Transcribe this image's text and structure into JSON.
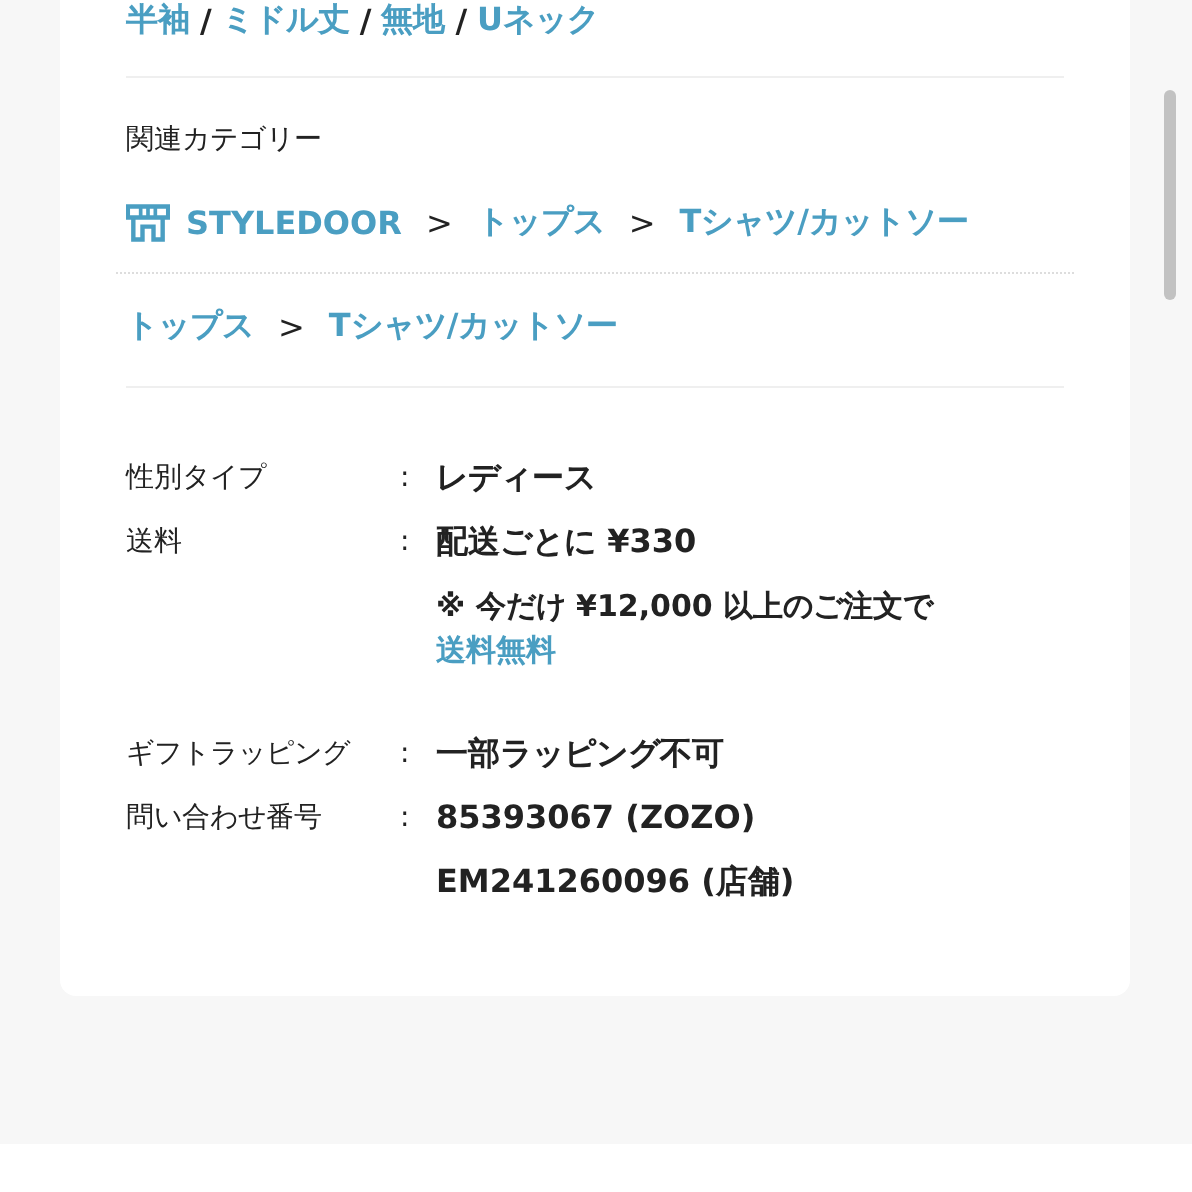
{
  "tags": [
    {
      "kind": "link",
      "text": "半袖"
    },
    {
      "kind": "separator",
      "text": "/"
    },
    {
      "kind": "link",
      "text": "ミドル丈"
    },
    {
      "kind": "separator",
      "text": "/"
    },
    {
      "kind": "link",
      "text": "無地"
    },
    {
      "kind": "separator",
      "text": "/"
    },
    {
      "kind": "link",
      "text": "Uネック"
    }
  ],
  "related_categories": {
    "heading": "関連カテゴリー",
    "paths": [
      {
        "kind": "shop",
        "items": [
          {
            "kind": "link",
            "text": "STYLEDOOR"
          },
          {
            "kind": "separator",
            "text": ">"
          },
          {
            "kind": "link",
            "text": "トップス"
          },
          {
            "kind": "separator",
            "text": ">"
          },
          {
            "kind": "link",
            "text": "Tシャツ/カットソー"
          }
        ]
      },
      {
        "kind": "category",
        "items": [
          {
            "kind": "link",
            "text": "トップス"
          },
          {
            "kind": "separator",
            "text": ">"
          },
          {
            "kind": "link",
            "text": "Tシャツ/カットソー"
          }
        ]
      }
    ]
  },
  "details": [
    {
      "label": "性別タイプ",
      "colon": ":",
      "values": [
        {
          "kind": "text",
          "text": "レディース"
        }
      ]
    },
    {
      "label": "送料",
      "colon": ":",
      "values": [
        {
          "kind": "text",
          "text": "配送ごとに ¥330"
        },
        {
          "kind": "note",
          "text": "※ 今だけ ¥12,000 以上のご注文で",
          "link": "送料無料"
        }
      ]
    },
    {
      "label": "ギフトラッピング",
      "colon": ":",
      "values": [
        {
          "kind": "text",
          "text": "一部ラッピング不可"
        }
      ]
    },
    {
      "label": "問い合わせ番号",
      "colon": ":",
      "values": [
        {
          "kind": "text",
          "text": "85393067 (ZOZO)"
        },
        {
          "kind": "text",
          "text": "EM241260096 (店舗)"
        }
      ]
    }
  ]
}
